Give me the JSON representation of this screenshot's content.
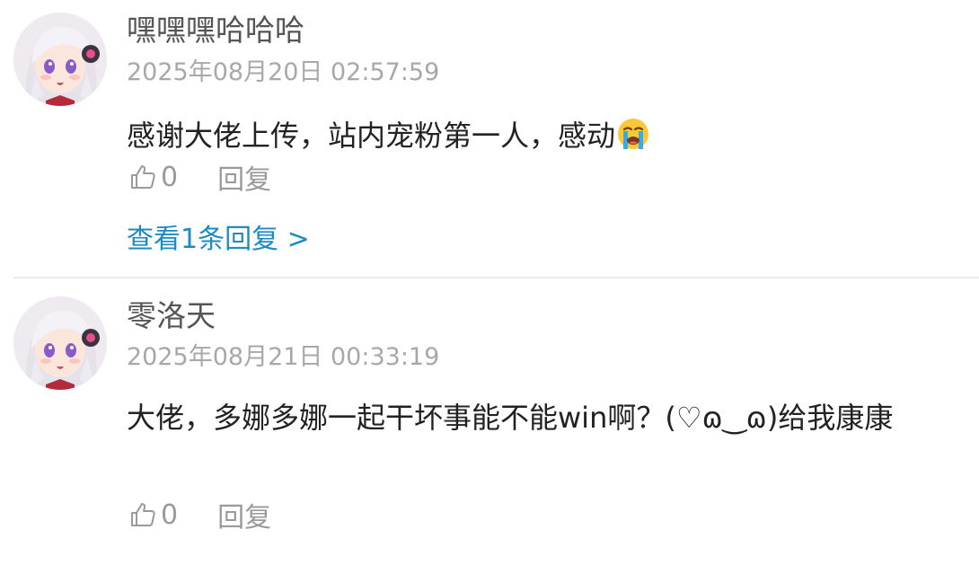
{
  "comments": [
    {
      "username": "嘿嘿嘿哈哈哈",
      "timestamp": "2025年08月20日 02:57:59",
      "content": "感谢大佬上传，站内宠粉第一人，感动",
      "content_emoji": "loudly-crying-face-emoji",
      "like_count": "0",
      "reply_label": "回复",
      "view_replies_label": "查看1条回复 >"
    },
    {
      "username": "零洛天",
      "timestamp": "2025年08月21日 00:33:19",
      "content": "大佬，多娜多娜一起干坏事能不能win啊？(♡ɷ‿ɷ)给我康康",
      "like_count": "0",
      "reply_label": "回复"
    }
  ],
  "icons": {
    "like": "thumbs-up-icon",
    "avatar": "anime-girl-avatar"
  },
  "colors": {
    "link": "#1c8bc5",
    "timestamp": "#a8a8a8",
    "username": "#555555",
    "content": "#222222"
  }
}
